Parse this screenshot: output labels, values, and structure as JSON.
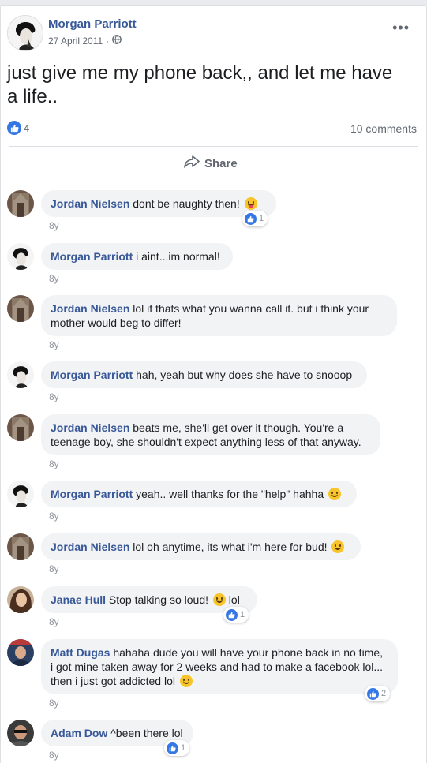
{
  "post": {
    "author": "Morgan Parriott",
    "date": "27 April 2011",
    "separator": "·",
    "text": "just give me my phone back,, and let me have a life..",
    "like_count": "4",
    "comments_label": "10 comments",
    "share_label": "Share",
    "more": "•••"
  },
  "comments": [
    {
      "name": "Jordan Nielsen",
      "text": "dont be naughty then!",
      "emoji": "tongue",
      "time": "8y",
      "likes": "1"
    },
    {
      "name": "Morgan Parriott",
      "text": "i aint...im normal!",
      "time": "8y"
    },
    {
      "name": "Jordan Nielsen",
      "text": "lol if thats what you wanna call it. but i think your mother would beg to differ!",
      "time": "8y"
    },
    {
      "name": "Morgan Parriott",
      "text": "hah, yeah but why does she have to snooop",
      "time": "8y"
    },
    {
      "name": "Jordan Nielsen",
      "text": "beats me, she'll get over it though. You're a teenage boy, she shouldn't expect anything less of that anyway.",
      "time": "8y"
    },
    {
      "name": "Morgan Parriott",
      "text": "yeah.. well thanks for the \"help\" hahha",
      "emoji": "smile",
      "time": "8y"
    },
    {
      "name": "Jordan Nielsen",
      "text": "lol oh anytime, its what i'm here for bud!",
      "emoji": "smile",
      "time": "8y"
    },
    {
      "name": "Janae Hull",
      "text": "Stop talking so loud!",
      "emoji": "smile",
      "text_after": "lol",
      "time": "8y",
      "likes": "1"
    },
    {
      "name": "Matt Dugas",
      "text": "hahaha dude you will have your phone back in no time, i got mine taken away for 2 weeks and had to make a facebook lol... then i just got addicted lol",
      "emoji": "smile",
      "time": "8y",
      "likes": "2"
    },
    {
      "name": "Adam Dow",
      "text": "^been there lol",
      "time": "8y",
      "likes": "1"
    }
  ],
  "colors": {
    "link": "#385898",
    "like": "#3578e5",
    "bubble": "#f2f3f5"
  }
}
